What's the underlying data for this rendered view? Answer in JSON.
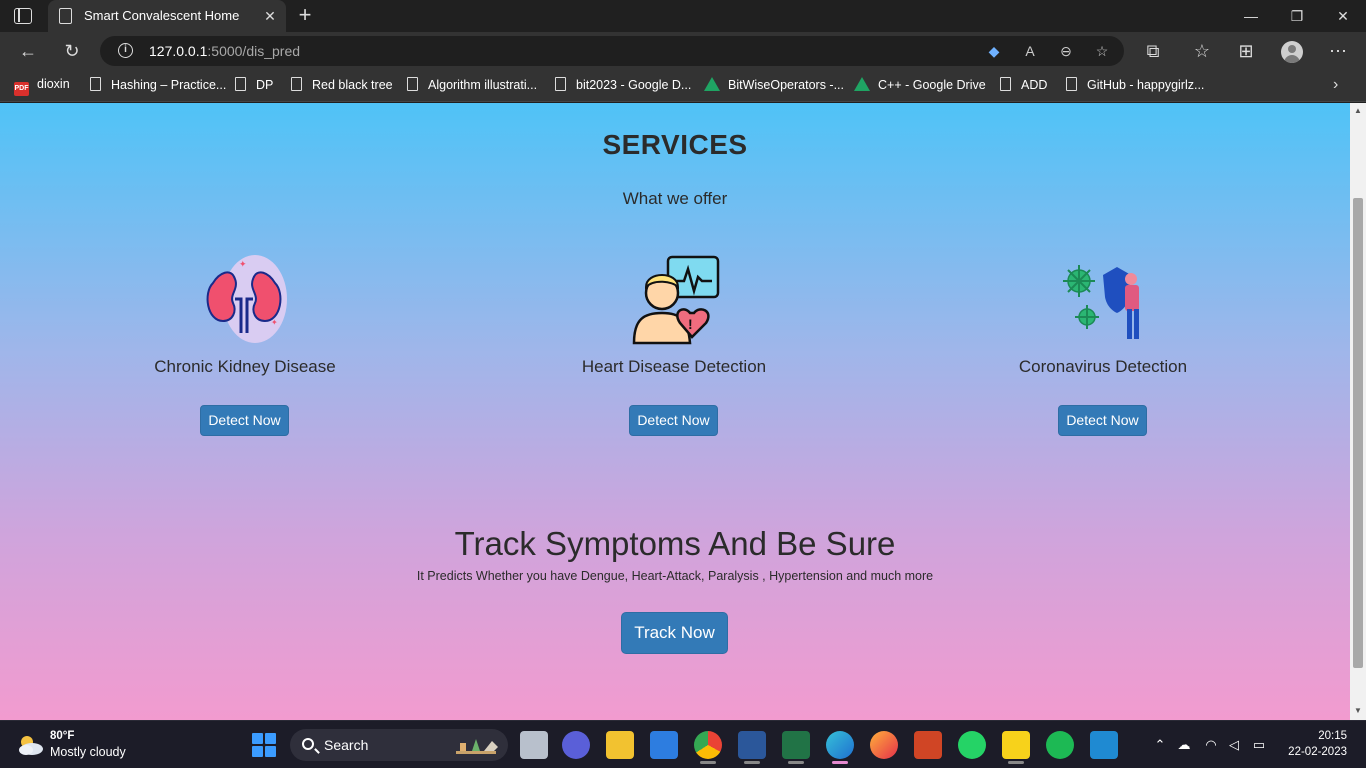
{
  "browser": {
    "tab_title": "Smart Convalescent Home",
    "url_host": "127.0.0.1",
    "url_path": ":5000/dis_pred"
  },
  "bookmarks": [
    {
      "label": "dioxin",
      "icon": "pdf-icon"
    },
    {
      "label": "Hashing – Practice...",
      "icon": "page-icon"
    },
    {
      "label": "DP",
      "icon": "page-icon"
    },
    {
      "label": "Red black tree",
      "icon": "page-icon"
    },
    {
      "label": "Algorithm illustrati...",
      "icon": "page-icon"
    },
    {
      "label": "bit2023 - Google D...",
      "icon": "page-icon"
    },
    {
      "label": "BitWiseOperators -...",
      "icon": "google-drive-icon"
    },
    {
      "label": "C++ - Google Drive",
      "icon": "google-drive-icon"
    },
    {
      "label": "ADD",
      "icon": "page-icon"
    },
    {
      "label": "GitHub - happygirlz...",
      "icon": "page-icon"
    }
  ],
  "page": {
    "services_title": "SERVICES",
    "services_subtitle": "What we offer",
    "cards": [
      {
        "title": "Chronic Kidney Disease",
        "button": "Detect Now",
        "icon": "kidney-icon"
      },
      {
        "title": "Heart Disease Detection",
        "button": "Detect Now",
        "icon": "heart-monitor-icon"
      },
      {
        "title": "Coronavirus Detection",
        "button": "Detect Now",
        "icon": "virus-shield-icon"
      }
    ],
    "track_title": "Track Symptoms And Be Sure",
    "track_subtitle": "It Predicts Whether you have Dengue, Heart-Attack, Paralysis , Hypertension and much more",
    "track_button": "Track Now",
    "gradient_top": "#4fc3f7",
    "gradient_bottom": "#f29bcf",
    "button_color": "#337ab7"
  },
  "taskbar": {
    "weather_temp": "80°F",
    "weather_desc": "Mostly cloudy",
    "search_label": "Search",
    "time": "20:15",
    "date": "22-02-2023"
  }
}
